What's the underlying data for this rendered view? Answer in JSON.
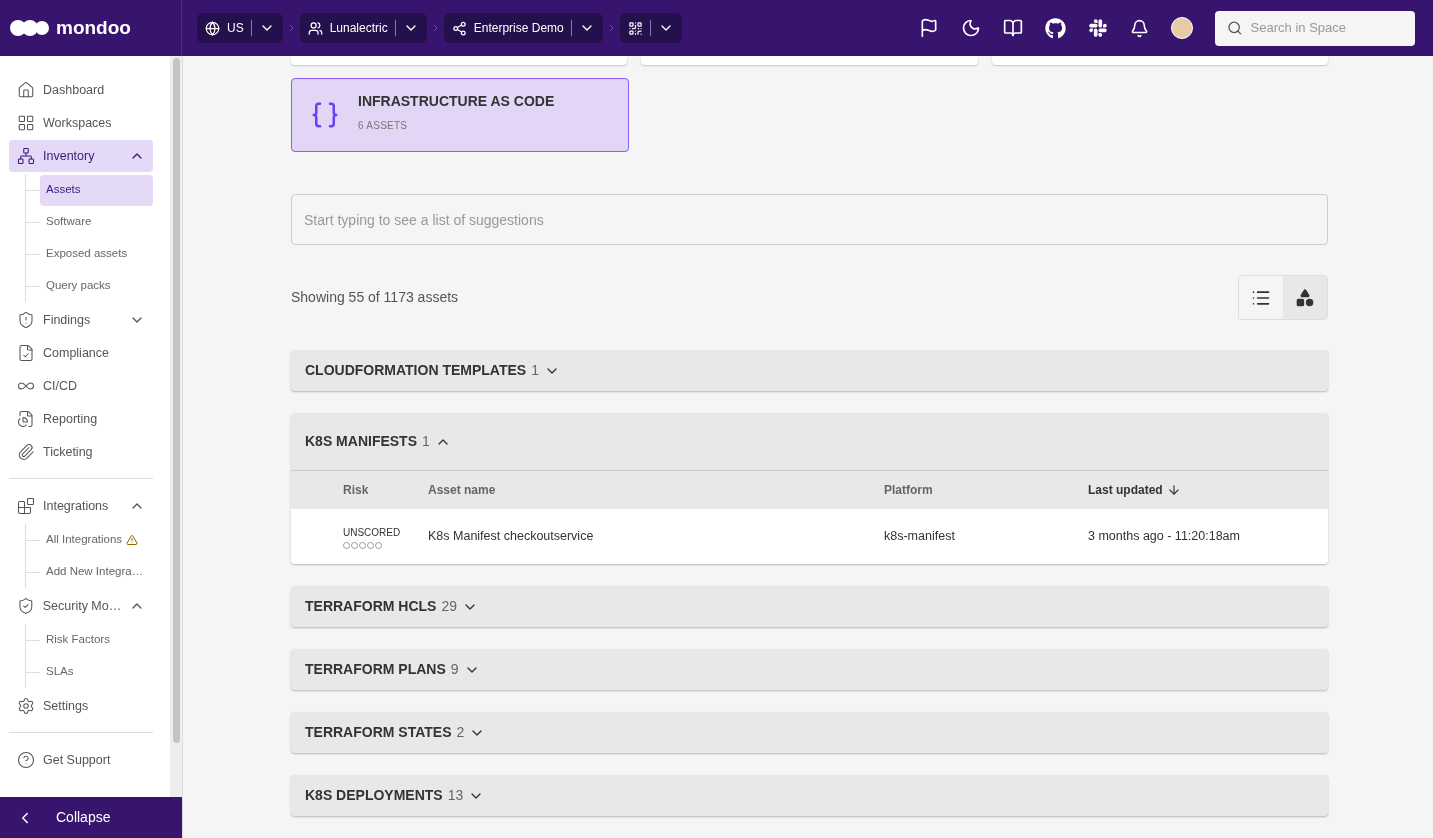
{
  "header": {
    "logo": "mondoo",
    "breadcrumbs": [
      {
        "kind": "region",
        "label": "US"
      },
      {
        "kind": "organization",
        "label": "Lunalectric"
      },
      {
        "kind": "space",
        "label": "Enterprise Demo"
      },
      {
        "kind": "view"
      }
    ],
    "search": {
      "placeholder": "Search in Space"
    }
  },
  "sidebar": {
    "sections": [
      {
        "items": [
          {
            "label": "Dashboard",
            "selected": false
          },
          {
            "label": "Workspaces",
            "selected": false
          },
          {
            "label": "Inventory",
            "selected": true,
            "expanded": true,
            "children": [
              {
                "label": "Assets",
                "selected": true,
                "alert": false
              },
              {
                "label": "Software",
                "selected": false,
                "alert": false
              },
              {
                "label": "Exposed assets",
                "selected": false,
                "alert": false
              },
              {
                "label": "Query packs",
                "selected": false,
                "alert": false
              }
            ]
          },
          {
            "label": "Findings",
            "selected": false,
            "expanded": false
          },
          {
            "label": "Compliance",
            "selected": false
          },
          {
            "label": "CI/CD",
            "selected": false
          },
          {
            "label": "Reporting",
            "selected": false
          },
          {
            "label": "Ticketing",
            "selected": false
          }
        ]
      },
      {
        "items": [
          {
            "label": "Integrations",
            "selected": false,
            "expanded": true,
            "children": [
              {
                "label": "All Integrations",
                "selected": false,
                "alert": true
              },
              {
                "label": "Add New Integra…",
                "selected": false,
                "alert": false
              }
            ]
          },
          {
            "label": "Security Mo…",
            "selected": false,
            "expanded": true,
            "children": [
              {
                "label": "Risk Factors",
                "selected": false,
                "alert": false
              },
              {
                "label": "SLAs",
                "selected": false,
                "alert": false
              }
            ]
          },
          {
            "label": "Settings",
            "selected": false
          }
        ]
      },
      {
        "items": [
          {
            "label": "Get Support",
            "selected": false
          }
        ]
      }
    ],
    "collapse": "Collapse"
  },
  "category_card": {
    "title": "INFRASTRUCTURE AS CODE",
    "subtitle": "6 ASSETS",
    "selected": true
  },
  "filter": {
    "placeholder": "Start typing to see a list of suggestions"
  },
  "summary": "Showing 55 of 1173 assets",
  "view_modes": [
    {
      "kind": "list",
      "selected": false
    },
    {
      "kind": "shapes",
      "selected": true
    }
  ],
  "groups": [
    {
      "title": "CLOUDFORMATION TEMPLATES",
      "count": "1",
      "expanded": false
    },
    {
      "title": "K8S MANIFESTS",
      "count": "1",
      "expanded": true,
      "table": {
        "columns": [
          {
            "label": "Risk",
            "sorted": false
          },
          {
            "label": "Asset name",
            "sorted": false
          },
          {
            "label": "Platform",
            "sorted": false
          },
          {
            "label": "Last updated",
            "sorted": true
          }
        ],
        "rows": [
          {
            "risk": "UNSCORED",
            "stars": 0,
            "name": "K8s Manifest checkoutservice",
            "platform": "k8s-manifest",
            "updated": "3 months ago - 11:20:18am"
          }
        ]
      }
    },
    {
      "title": "TERRAFORM HCLS",
      "count": "29",
      "expanded": false
    },
    {
      "title": "TERRAFORM PLANS",
      "count": "9",
      "expanded": false
    },
    {
      "title": "TERRAFORM STATES",
      "count": "2",
      "expanded": false
    },
    {
      "title": "K8S DEPLOYMENTS",
      "count": "13",
      "expanded": false
    }
  ]
}
